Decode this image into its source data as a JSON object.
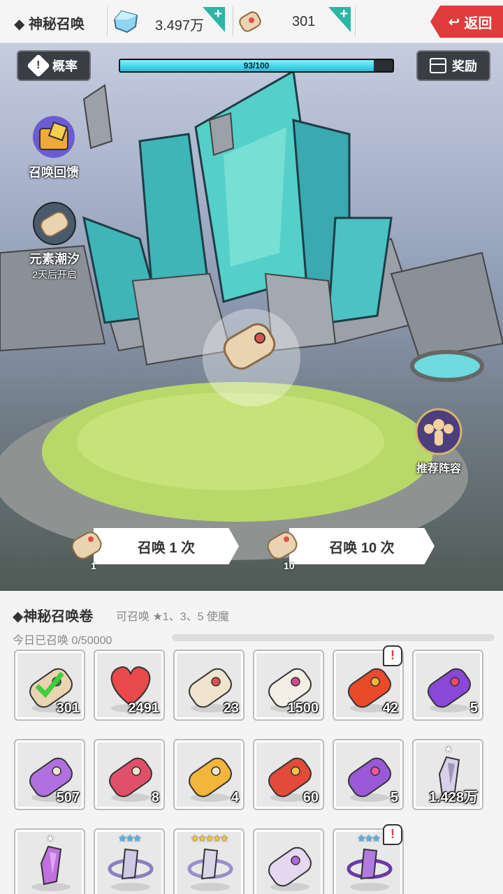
{
  "header": {
    "title": "◆ 神秘召唤",
    "gems": "3.497万",
    "scrolls": "301",
    "back_label": "返回",
    "accent": "#e13b3b"
  },
  "scene": {
    "rate_label": "概率",
    "reward_label": "奖励",
    "progress_text": "93/100",
    "progress_value": 0.93,
    "feedback_label": "召唤回馈",
    "tide_label": "元素潮汐",
    "tide_sub": "2天后开启",
    "lineup_label": "推荐阵容",
    "summon_one_label": "召唤 1 次",
    "summon_one_cost": "1",
    "summon_ten_label": "召唤 10 次",
    "summon_ten_cost": "10"
  },
  "panel": {
    "title": "◆神秘召唤卷",
    "desc": "可召唤 ★1、3、5 使魔",
    "today": "今日已召唤 0/50000",
    "items": [
      {
        "name": "green-check-scroll",
        "count": "301"
      },
      {
        "name": "heart",
        "count": "2491"
      },
      {
        "name": "winged-scroll",
        "count": "23"
      },
      {
        "name": "open-scroll",
        "count": "1500"
      },
      {
        "name": "red-bell-scroll",
        "count": "42",
        "alert": true
      },
      {
        "name": "purple-bell-scroll",
        "count": "5"
      },
      {
        "name": "purple-scroll",
        "count": "507"
      },
      {
        "name": "red-scroll",
        "count": "8"
      },
      {
        "name": "gold-scroll",
        "count": "4"
      },
      {
        "name": "red-ornate-scroll",
        "count": "60"
      },
      {
        "name": "purple-ornate-scroll",
        "count": "5"
      },
      {
        "name": "crystal-shard",
        "count": "1.428万",
        "stars": "★"
      },
      {
        "name": "purple-shard",
        "count": "",
        "stars": "★"
      },
      {
        "name": "silver-ring-1",
        "count": "",
        "stars": "★★★"
      },
      {
        "name": "silver-ring-2",
        "count": "",
        "stars": "★★★★★"
      },
      {
        "name": "pink-winged-scroll",
        "count": ""
      },
      {
        "name": "purple-ring",
        "count": "",
        "stars": "★★★",
        "alert": true
      }
    ]
  }
}
